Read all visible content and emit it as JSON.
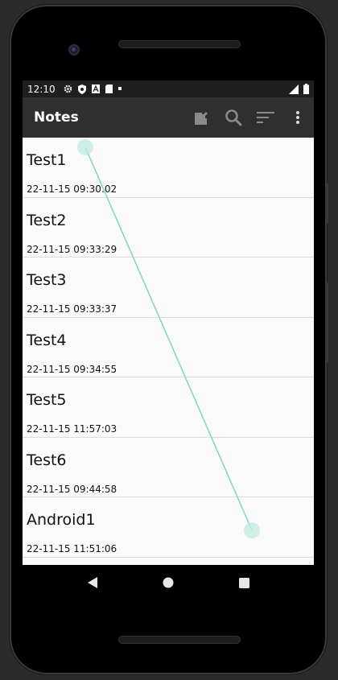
{
  "status_bar": {
    "time": "12:10",
    "icons": [
      "gear-icon",
      "shield-icon",
      "a-icon",
      "sd-card-icon",
      "dot-icon"
    ],
    "right_icons": [
      "signal-icon",
      "battery-icon"
    ]
  },
  "app_bar": {
    "title": "Notes",
    "actions": [
      "edit-note-icon",
      "search-icon",
      "sort-icon",
      "more-vert-icon"
    ]
  },
  "notes": [
    {
      "title": "Test1",
      "date": "22-11-15 09:30:02"
    },
    {
      "title": "Test2",
      "date": "22-11-15 09:33:29"
    },
    {
      "title": "Test3",
      "date": "22-11-15 09:33:37"
    },
    {
      "title": "Test4",
      "date": "22-11-15 09:34:55"
    },
    {
      "title": "Test5",
      "date": "22-11-15 11:57:03"
    },
    {
      "title": "Test6",
      "date": "22-11-15 09:44:58"
    },
    {
      "title": "Android1",
      "date": "22-11-15 11:51:06"
    }
  ],
  "nav_bar": [
    "back-icon",
    "home-icon",
    "recents-icon"
  ],
  "colors": {
    "app_bar": "#2f2f2f",
    "status_bar": "#1f1f1f",
    "list_bg": "#fafafa",
    "gesture_trace": "#7fd6c4"
  }
}
